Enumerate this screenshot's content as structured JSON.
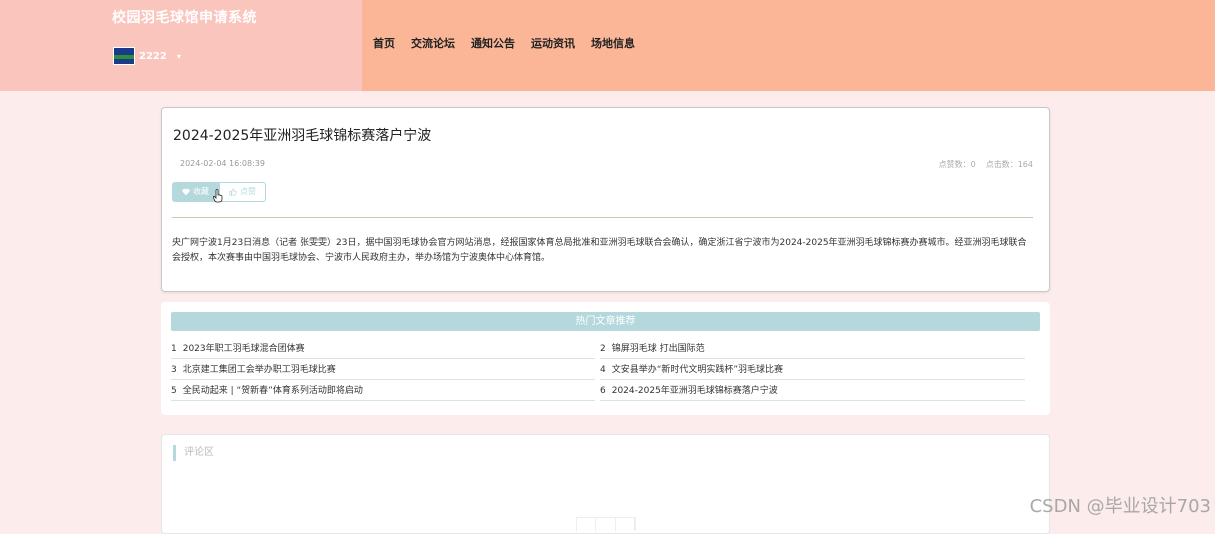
{
  "header": {
    "site_title": "校园羽毛球馆申请系统",
    "username": "2222",
    "caret": "▾"
  },
  "nav": {
    "items": [
      "首页",
      "交流论坛",
      "通知公告",
      "运动资讯",
      "场地信息"
    ]
  },
  "article": {
    "title": "2024-2025年亚洲羽毛球锦标赛落户宁波",
    "date": "2024-02-04 16:08:39",
    "likes": "点赞数：0",
    "clicks": "点击数：164",
    "collect_label": "收藏",
    "like_label": "点赞",
    "body": "央广网宁波1月23日消息（记者 张雯雯）23日，据中国羽毛球协会官方网站消息，经报国家体育总局批准和亚洲羽毛球联合会确认，确定浙江省宁波市为2024-2025年亚洲羽毛球锦标赛办赛城市。经亚洲羽毛球联合会授权，本次赛事由中国羽毛球协会、宁波市人民政府主办，举办场馆为宁波奥体中心体育馆。"
  },
  "hot": {
    "header": "热门文章推荐",
    "items": [
      {
        "num": "1",
        "title": "2023年职工羽毛球混合团体赛"
      },
      {
        "num": "2",
        "title": "锦屏羽毛球 打出国际范"
      },
      {
        "num": "3",
        "title": "北京建工集团工会举办职工羽毛球比赛"
      },
      {
        "num": "4",
        "title": "文安县举办“新时代文明实践杯”羽毛球比赛"
      },
      {
        "num": "5",
        "title": "全民动起来 | “贺新春”体育系列活动即将启动"
      },
      {
        "num": "6",
        "title": "2024-2025年亚洲羽毛球锦标赛落户宁波"
      }
    ]
  },
  "comments": {
    "title": "评论区"
  },
  "watermark": "CSDN @毕业设计703",
  "colors": {
    "header_bg": "#fbb597",
    "brand_bg": "#fac5bd",
    "accent": "#b4d8dc",
    "page_bg": "#fdecec"
  },
  "icons": {
    "collect": "heart-icon",
    "like": "thumb-up-icon",
    "dropdown": "caret-down-icon",
    "cursor": "hand-pointer-icon"
  }
}
